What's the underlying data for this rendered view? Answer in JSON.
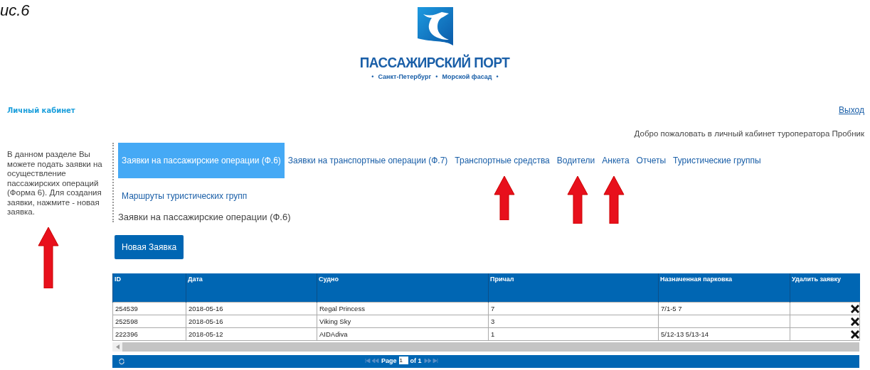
{
  "caption": "ис.6",
  "brand": {
    "title": "ПАССАЖИРСКИЙ ПОРТ",
    "subtitle_parts": [
      "Санкт-Петербург",
      "Морской фасад"
    ],
    "bullet": "•"
  },
  "section_title": "Личный кабинет",
  "logout": "Выход",
  "welcome": "Добро пожаловать в личный кабинет туроператора Пробник",
  "sidebar_text": "В данном разделе Вы можете подать заявки на осуществление пассажирских операций (Форма 6). Для создания заявки, нажмите - новая заявка.",
  "tabs": [
    {
      "label": "Заявки на пассажирские операции (Ф.6)",
      "selected": true
    },
    {
      "label": "Заявки на транспортные операции (Ф.7)",
      "selected": false
    },
    {
      "label": "Транспортные средства",
      "selected": false
    },
    {
      "label": "Водители",
      "selected": false
    },
    {
      "label": "Анкета",
      "selected": false
    },
    {
      "label": "Отчеты",
      "selected": false
    },
    {
      "label": "Туристические группы",
      "selected": false
    },
    {
      "label": "Маршруты туристических групп",
      "selected": false
    }
  ],
  "heading": "Заявки на пассажирские операции (Ф.6)",
  "new_button": "Новая Заявка",
  "table": {
    "columns": [
      "ID",
      "Дата",
      "Судно",
      "Причал",
      "Назначенная парковка",
      "Удалить заявку"
    ],
    "rows": [
      {
        "cells": [
          "254539",
          "2018-05-16",
          "Regal Princess",
          "7",
          "7/1-5 7"
        ]
      },
      {
        "cells": [
          "252598",
          "2018-05-16",
          "Viking Sky",
          "3",
          ""
        ]
      },
      {
        "cells": [
          "222396",
          "2018-05-12",
          "AIDAdiva",
          "1",
          "5/12-13 5/13-14"
        ]
      }
    ]
  },
  "pager": {
    "page_label": "Page",
    "page_value": "1",
    "of_label": "of 1"
  },
  "annotation_arrows": [
    {
      "kind": "arrow"
    },
    {
      "kind": "arrow"
    },
    {
      "kind": "arrow"
    },
    {
      "kind": "arrow"
    }
  ]
}
